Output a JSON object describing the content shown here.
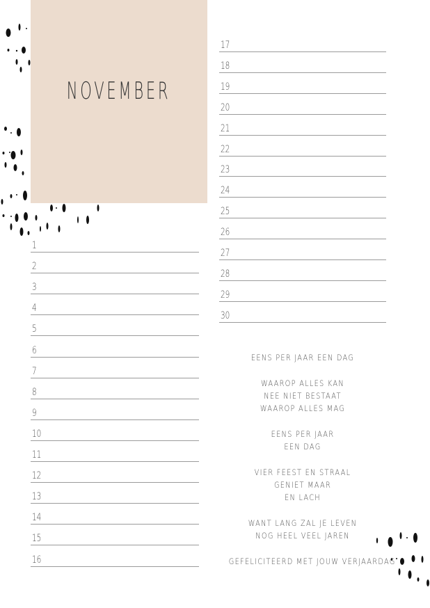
{
  "page": {
    "title": "NOVEMBER",
    "accent_color": "#ecdcce"
  },
  "left_days": [
    "1",
    "2",
    "3",
    "4",
    "5",
    "6",
    "7",
    "8",
    "9",
    "10",
    "11",
    "12",
    "13",
    "14",
    "15",
    "16"
  ],
  "right_days": [
    "17",
    "18",
    "19",
    "20",
    "21",
    "22",
    "23",
    "24",
    "25",
    "26",
    "27",
    "28",
    "29",
    "30"
  ],
  "poem": [
    "EENS PER JAAR EEN DAG",
    "",
    "WAAROP ALLES KAN",
    "NEE NIET BESTAAT",
    "WAAROP ALLES MAG",
    "",
    "EENS PER JAAR",
    "EEN DAG",
    "",
    "VIER FEEST EN STRAAL",
    "GENIET MAAR",
    "EN LACH",
    "",
    "WANT LANG ZAL JE LEVEN",
    "NOG HEEL VEEL JAREN",
    "",
    "GEFELICITEERD MET JOUW VERJAARDAG"
  ]
}
